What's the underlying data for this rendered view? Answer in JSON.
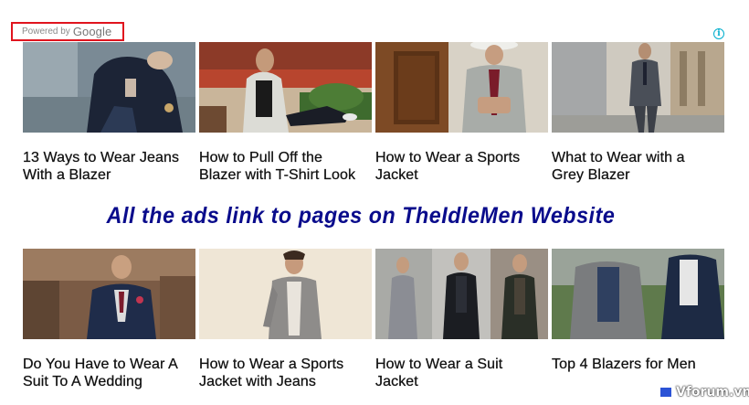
{
  "powered": {
    "prefix": "Powered by",
    "brand": "Google"
  },
  "info_icon": "i",
  "banner": "All the ads link to pages on TheIdleMen Website",
  "watermark": {
    "text": "Vforum.vn"
  },
  "ads": [
    {
      "line1": "13 Ways to Wear Jeans",
      "line2": "With a Blazer"
    },
    {
      "line1": "How to Pull Off the",
      "line2": "Blazer with T-Shirt Look"
    },
    {
      "line1": "How to Wear a Sports",
      "line2": "Jacket"
    },
    {
      "line1": "What to Wear with a",
      "line2": "Grey Blazer"
    },
    {
      "line1": "Do You Have to Wear A",
      "line2": "Suit To A Wedding"
    },
    {
      "line1": "How to Wear a Sports",
      "line2": "Jacket with Jeans"
    },
    {
      "line1": "How to Wear a Suit",
      "line2": "Jacket"
    },
    {
      "line1": "Top 4 Blazers for Men",
      "line2": ""
    }
  ]
}
